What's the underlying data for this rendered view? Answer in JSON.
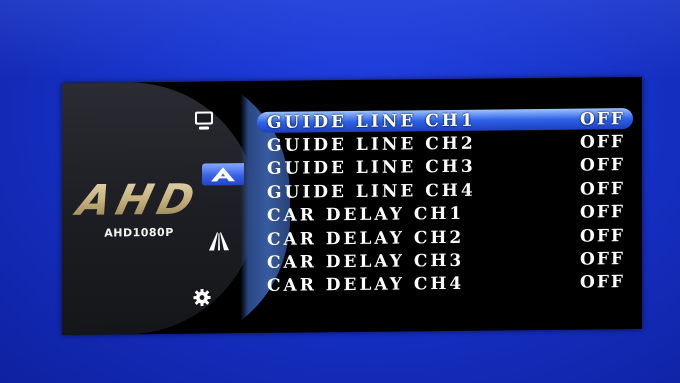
{
  "logo": {
    "brand": "AHD",
    "model": "AHD1080P"
  },
  "sidebar": {
    "icons": [
      "monitor-icon",
      "guide-line-icon",
      "road-icon",
      "gear-icon"
    ],
    "selected": "guide-line-icon"
  },
  "menu": {
    "items": [
      {
        "label": "GUIDE LINE CH1",
        "value": "OFF"
      },
      {
        "label": "GUIDE LINE CH2",
        "value": "OFF"
      },
      {
        "label": "GUIDE LINE CH3",
        "value": "OFF"
      },
      {
        "label": "GUIDE LINE CH4",
        "value": "OFF"
      },
      {
        "label": "CAR DELAY CH1",
        "value": "OFF"
      },
      {
        "label": "CAR DELAY CH2",
        "value": "OFF"
      },
      {
        "label": "CAR DELAY CH3",
        "value": "OFF"
      },
      {
        "label": "CAR DELAY CH4",
        "value": "OFF"
      }
    ],
    "selected_index": 0
  },
  "colors": {
    "background": "#1632c8",
    "panel": "#000000",
    "highlight": "#2f62e8",
    "logo_gold": "#c6b27d",
    "text": "#ffffff"
  }
}
